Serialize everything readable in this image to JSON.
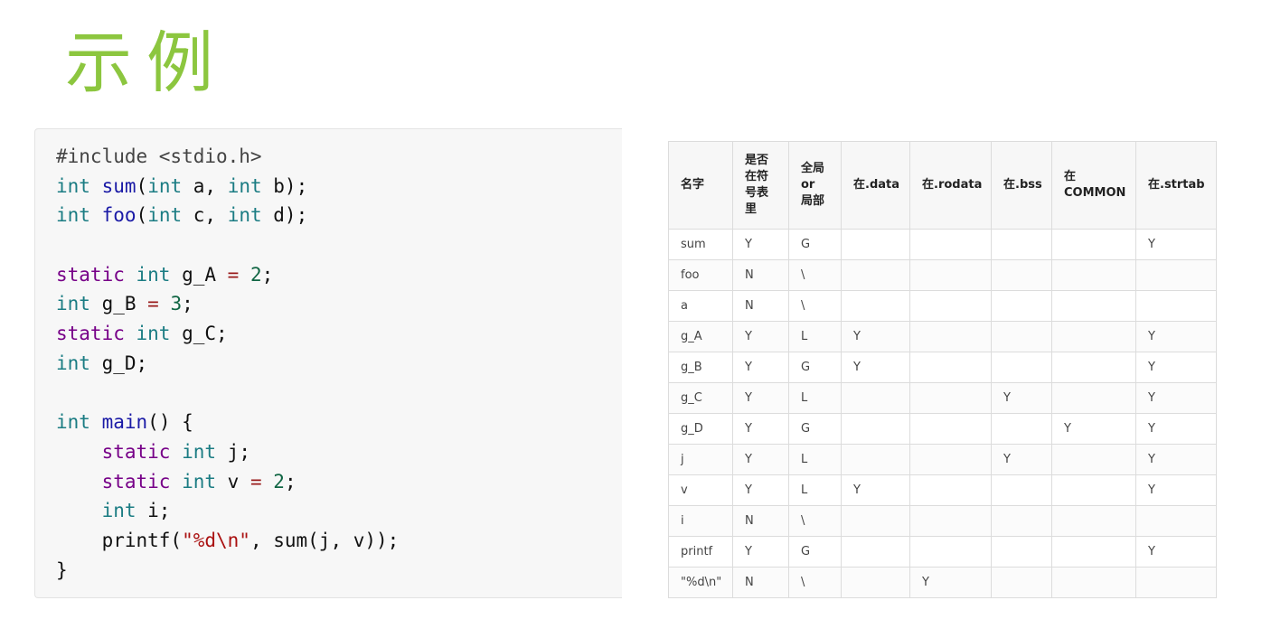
{
  "title": "示例",
  "code": {
    "lines": [
      [
        {
          "t": "pre",
          "v": "#include <stdio.h>"
        }
      ],
      [
        {
          "t": "type",
          "v": "int"
        },
        {
          "t": "plain",
          "v": " "
        },
        {
          "t": "fn",
          "v": "sum"
        },
        {
          "t": "plain",
          "v": "("
        },
        {
          "t": "type",
          "v": "int"
        },
        {
          "t": "plain",
          "v": " a, "
        },
        {
          "t": "type",
          "v": "int"
        },
        {
          "t": "plain",
          "v": " b);"
        }
      ],
      [
        {
          "t": "type",
          "v": "int"
        },
        {
          "t": "plain",
          "v": " "
        },
        {
          "t": "fn",
          "v": "foo"
        },
        {
          "t": "plain",
          "v": "("
        },
        {
          "t": "type",
          "v": "int"
        },
        {
          "t": "plain",
          "v": " c, "
        },
        {
          "t": "type",
          "v": "int"
        },
        {
          "t": "plain",
          "v": " d);"
        }
      ],
      [],
      [
        {
          "t": "kw",
          "v": "static"
        },
        {
          "t": "plain",
          "v": " "
        },
        {
          "t": "type",
          "v": "int"
        },
        {
          "t": "plain",
          "v": " g_A "
        },
        {
          "t": "op",
          "v": "="
        },
        {
          "t": "plain",
          "v": " "
        },
        {
          "t": "num",
          "v": "2"
        },
        {
          "t": "plain",
          "v": ";"
        }
      ],
      [
        {
          "t": "type",
          "v": "int"
        },
        {
          "t": "plain",
          "v": " g_B "
        },
        {
          "t": "op",
          "v": "="
        },
        {
          "t": "plain",
          "v": " "
        },
        {
          "t": "num",
          "v": "3"
        },
        {
          "t": "plain",
          "v": ";"
        }
      ],
      [
        {
          "t": "kw",
          "v": "static"
        },
        {
          "t": "plain",
          "v": " "
        },
        {
          "t": "type",
          "v": "int"
        },
        {
          "t": "plain",
          "v": " g_C;"
        }
      ],
      [
        {
          "t": "type",
          "v": "int"
        },
        {
          "t": "plain",
          "v": " g_D;"
        }
      ],
      [],
      [
        {
          "t": "type",
          "v": "int"
        },
        {
          "t": "plain",
          "v": " "
        },
        {
          "t": "fn",
          "v": "main"
        },
        {
          "t": "plain",
          "v": "() {"
        }
      ],
      [
        {
          "t": "plain",
          "v": "    "
        },
        {
          "t": "kw",
          "v": "static"
        },
        {
          "t": "plain",
          "v": " "
        },
        {
          "t": "type",
          "v": "int"
        },
        {
          "t": "plain",
          "v": " j;"
        }
      ],
      [
        {
          "t": "plain",
          "v": "    "
        },
        {
          "t": "kw",
          "v": "static"
        },
        {
          "t": "plain",
          "v": " "
        },
        {
          "t": "type",
          "v": "int"
        },
        {
          "t": "plain",
          "v": " v "
        },
        {
          "t": "op",
          "v": "="
        },
        {
          "t": "plain",
          "v": " "
        },
        {
          "t": "num",
          "v": "2"
        },
        {
          "t": "plain",
          "v": ";"
        }
      ],
      [
        {
          "t": "plain",
          "v": "    "
        },
        {
          "t": "type",
          "v": "int"
        },
        {
          "t": "plain",
          "v": " i;"
        }
      ],
      [
        {
          "t": "plain",
          "v": "    printf("
        },
        {
          "t": "str",
          "v": "\"%d\\n\""
        },
        {
          "t": "plain",
          "v": ", sum(j, v));"
        }
      ],
      [
        {
          "t": "plain",
          "v": "}"
        }
      ]
    ]
  },
  "table": {
    "headers": [
      [
        "名字"
      ],
      [
        "是否",
        "在符",
        "号表",
        "里"
      ],
      [
        "全局",
        "or",
        "局部"
      ],
      [
        "在.data"
      ],
      [
        "在.rodata"
      ],
      [
        "在.bss"
      ],
      [
        "在",
        "COMMON"
      ],
      [
        "在.strtab"
      ]
    ],
    "rows": [
      [
        "sum",
        "Y",
        "G",
        "",
        "",
        "",
        "",
        "Y"
      ],
      [
        "foo",
        "N",
        "\\",
        "",
        "",
        "",
        "",
        ""
      ],
      [
        "a",
        "N",
        "\\",
        "",
        "",
        "",
        "",
        ""
      ],
      [
        "g_A",
        "Y",
        "L",
        "Y",
        "",
        "",
        "",
        "Y"
      ],
      [
        "g_B",
        "Y",
        "G",
        "Y",
        "",
        "",
        "",
        "Y"
      ],
      [
        "g_C",
        "Y",
        "L",
        "",
        "",
        "Y",
        "",
        "Y"
      ],
      [
        "g_D",
        "Y",
        "G",
        "",
        "",
        "",
        "Y",
        "Y"
      ],
      [
        "j",
        "Y",
        "L",
        "",
        "",
        "Y",
        "",
        "Y"
      ],
      [
        "v",
        "Y",
        "L",
        "Y",
        "",
        "",
        "",
        "Y"
      ],
      [
        "i",
        "N",
        "\\",
        "",
        "",
        "",
        "",
        ""
      ],
      [
        "printf",
        "Y",
        "G",
        "",
        "",
        "",
        "",
        "Y"
      ],
      [
        "\"%d\\n\"",
        "N",
        "\\",
        "",
        "Y",
        "",
        "",
        ""
      ]
    ]
  },
  "colors": {
    "title": "#8cc63f",
    "code_bg": "#f7f7f7",
    "type": "#1b7c83",
    "keyword": "#770088",
    "function": "#1a1aa6",
    "number": "#116644",
    "operator": "#981a1a",
    "string": "#aa1111"
  }
}
